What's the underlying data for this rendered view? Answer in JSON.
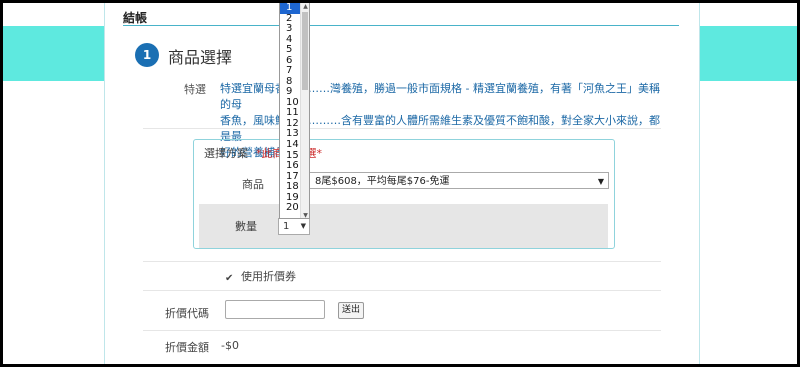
{
  "header": {
    "title": "結帳"
  },
  "step": {
    "number": "1",
    "title": "商品選擇"
  },
  "feature": {
    "label": "特選",
    "line1": "特選宜蘭母香…………灣養殖，勝過一般市面規格 - 精選宜蘭養殖，有著「河魚之王」美稱的母",
    "line2": "香魚，風味鮮……………含有豐富的人體所需維生素及優質不飽和酸，對全家大小來說，都是最",
    "line3": "好的營養補品"
  },
  "plan": {
    "label": "選擇方案",
    "note": "*此商……選*",
    "product_label": "商品",
    "product_value": "8尾$608，平均每尾$76-免運",
    "quantity_label": "數量",
    "quantity_value": "1"
  },
  "coupon": {
    "label": "使用折價券",
    "checked": true,
    "check_glyph": "✔"
  },
  "discount": {
    "code_label": "折價代碼",
    "code_value": "",
    "send_label": "送出",
    "amount_label": "折價金額",
    "amount_value": "-$0"
  },
  "quantity_dropdown": {
    "options": [
      "1",
      "2",
      "3",
      "4",
      "5",
      "6",
      "7",
      "8",
      "9",
      "10",
      "11",
      "12",
      "13",
      "14",
      "15",
      "16",
      "17",
      "18",
      "19",
      "20"
    ],
    "selected": "1"
  },
  "icons": {
    "chevron_down": "▼",
    "scroll_up": "▲",
    "scroll_down": "▼"
  }
}
